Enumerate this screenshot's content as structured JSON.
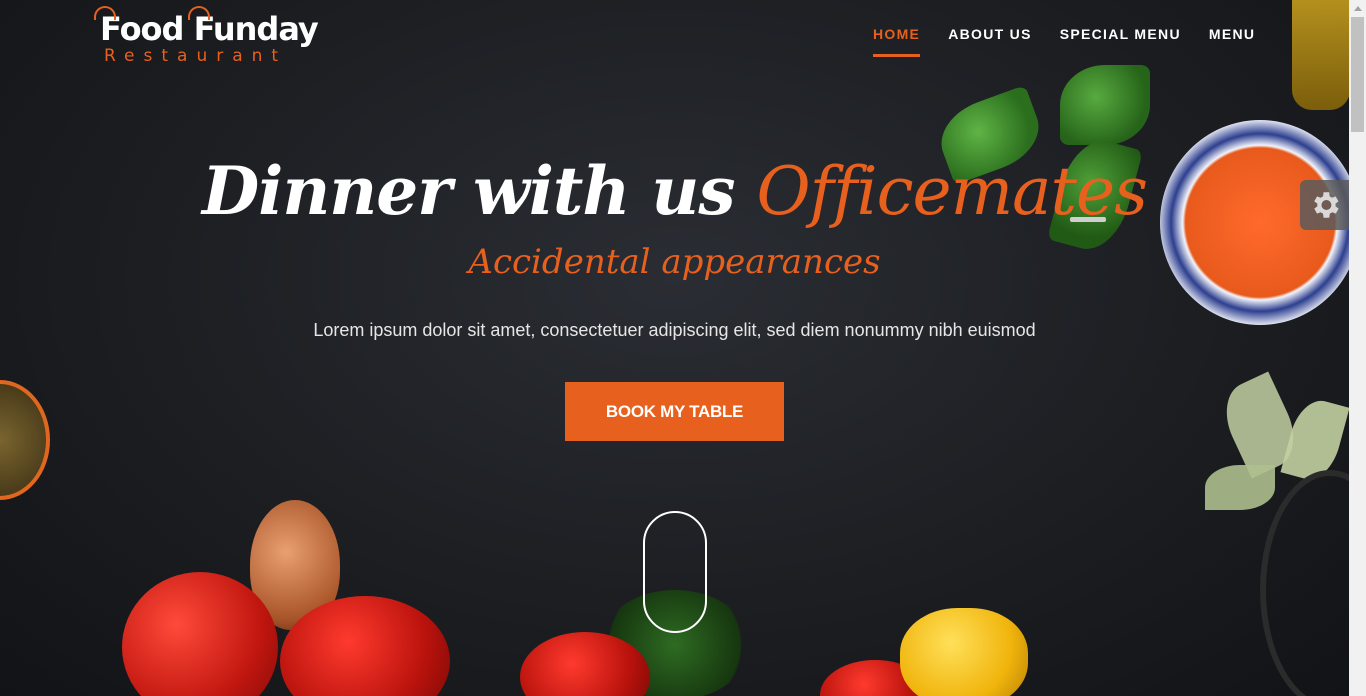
{
  "brand": {
    "name": "Food Funday",
    "tagline": "Restaurant"
  },
  "nav": {
    "items": [
      {
        "label": "HOME",
        "active": true
      },
      {
        "label": "ABOUT US",
        "active": false
      },
      {
        "label": "SPECIAL MENU",
        "active": false
      },
      {
        "label": "MENU",
        "active": false
      }
    ]
  },
  "hero": {
    "headline_main": "Dinner with us ",
    "headline_accent": "Officemates",
    "subheadline": "Accidental appearances",
    "lead": "Lorem ipsum dolor sit amet, consectetuer adipiscing elit, sed diem nonummy nibh euismod",
    "cta_label": "BOOK MY TABLE"
  },
  "widgets": {
    "settings_icon": "gear-icon",
    "scroll_indicator_icon": "mouse-scroll-icon"
  },
  "colors": {
    "accent": "#e8601e",
    "text": "#ffffff",
    "background": "#1c1e22"
  }
}
